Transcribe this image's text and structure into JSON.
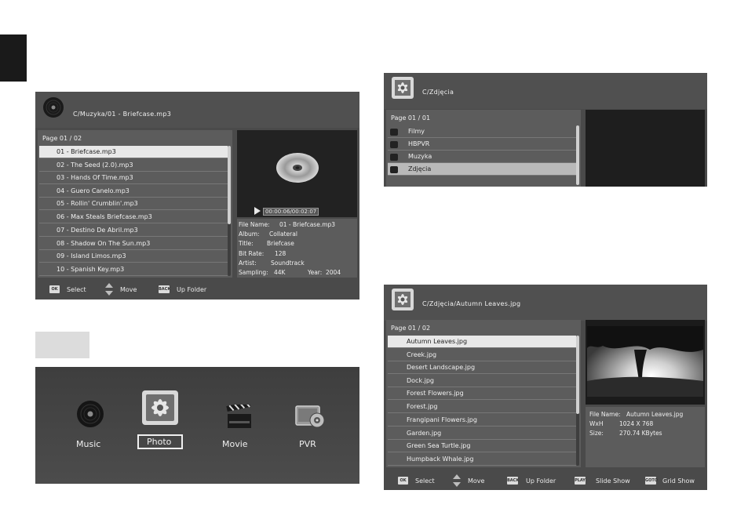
{
  "music_screen": {
    "path": "C/Muzyka/01 - Briefcase.mp3",
    "page": "Page  01 / 02",
    "files": [
      "01 - Briefcase.mp3",
      "02 - The Seed (2.0).mp3",
      "03 - Hands Of Time.mp3",
      "04 - Guero Canelo.mp3",
      "05 - Rollin' Crumblin'.mp3",
      "06 - Max Steals Briefcase.mp3",
      "07 - Destino De Abril.mp3",
      "08 - Shadow On The Sun.mp3",
      "09 - Island Limos.mp3",
      "10 - Spanish Key.mp3"
    ],
    "time": "00:00:06/00:02:07",
    "info": {
      "file_name_label": "File Name:",
      "file_name": "01 - Briefcase.mp3",
      "album_label": "Album:",
      "album": "Collateral",
      "title_label": "Title:",
      "title": "Briefcase",
      "bitrate_label": "Bit Rate:",
      "bitrate": "128",
      "artist_label": "Artist:",
      "artist": "Soundtrack",
      "sampling_label": "Sampling:",
      "sampling": "44K",
      "year_label": "Year:",
      "year": "2004"
    },
    "footer": {
      "ok_key": "OK",
      "select": "Select",
      "move": "Move",
      "back_key": "BACK",
      "up_folder": "Up Folder"
    }
  },
  "menu_screen": {
    "items": [
      "Music",
      "Photo",
      "Movie",
      "PVR"
    ]
  },
  "folder_screen": {
    "path": "C/Zdjęcia",
    "page": "Page  01 / 01",
    "folders": [
      "Filmy",
      "HBPVR",
      "Muzyka",
      "Zdjęcia"
    ]
  },
  "photo_screen": {
    "path": "C/Zdjęcia/Autumn Leaves.jpg",
    "page": "Page  01 / 02",
    "files": [
      "Autumn Leaves.jpg",
      "Creek.jpg",
      "Desert Landscape.jpg",
      "Dock.jpg",
      "Forest Flowers.jpg",
      "Forest.jpg",
      "Frangipani Flowers.jpg",
      "Garden.jpg",
      "Green Sea Turtle.jpg",
      "Humpback Whale.jpg"
    ],
    "info": {
      "file_name_label": "File Name:",
      "file_name": "Autumn Leaves.jpg",
      "wxh_label": "WxH",
      "wxh": "1024 X 768",
      "size_label": "Size:",
      "size": "270.74 KBytes"
    },
    "footer": {
      "ok_key": "OK",
      "select": "Select",
      "move": "Move",
      "back_key": "BACK",
      "up_folder": "Up Folder",
      "play_key": "PLAY",
      "slide_show": "Slide Show",
      "goto_key": "GOTO",
      "grid_show": "Grid Show"
    }
  }
}
